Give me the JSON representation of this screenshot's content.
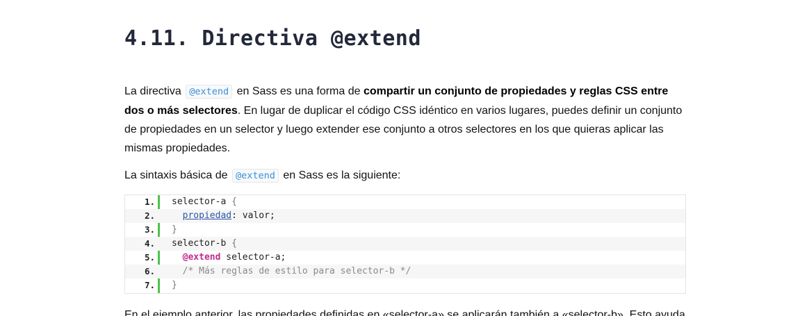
{
  "heading": "4.11. Directiva @extend",
  "para1": {
    "t1": "La directiva",
    "code": "@extend",
    "t2": "en Sass es una forma de",
    "bold1": "compartir un conjunto de propiedades y reglas CSS entre dos o",
    "bold2": "más selectores",
    "t3": ". En lugar de duplicar el código CSS idéntico en varios lugares, puedes definir un conjunto de propiedades en un selector y luego extender ese conjunto a otros selectores en los que quieras aplicar las mismas propiedades."
  },
  "para2": {
    "t1": "La sintaxis básica de",
    "code": "@extend",
    "t2": "en Sass es la siguiente:"
  },
  "code_lines": [
    {
      "num": "1.",
      "parts": [
        [
          "plain",
          "selector-a "
        ],
        [
          "brace",
          "{"
        ]
      ]
    },
    {
      "num": "2.",
      "parts": [
        [
          "plain",
          "  "
        ],
        [
          "prop",
          "propiedad"
        ],
        [
          "plain",
          ": valor;"
        ]
      ]
    },
    {
      "num": "3.",
      "parts": [
        [
          "brace",
          "}"
        ]
      ]
    },
    {
      "num": "4.",
      "parts": [
        [
          "plain",
          "selector-b "
        ],
        [
          "brace",
          "{"
        ]
      ]
    },
    {
      "num": "5.",
      "parts": [
        [
          "plain",
          "  "
        ],
        [
          "kw",
          "@extend"
        ],
        [
          "plain",
          " selector-a;"
        ]
      ]
    },
    {
      "num": "6.",
      "parts": [
        [
          "plain",
          "  "
        ],
        [
          "comment",
          "/* Más reglas de estilo para selector-b */"
        ]
      ]
    },
    {
      "num": "7.",
      "parts": [
        [
          "brace",
          "}"
        ]
      ]
    }
  ],
  "para3": "En el ejemplo anterior, las propiedades definidas en «selector-a» se aplicarán también a «selector-b». Esto ayuda"
}
